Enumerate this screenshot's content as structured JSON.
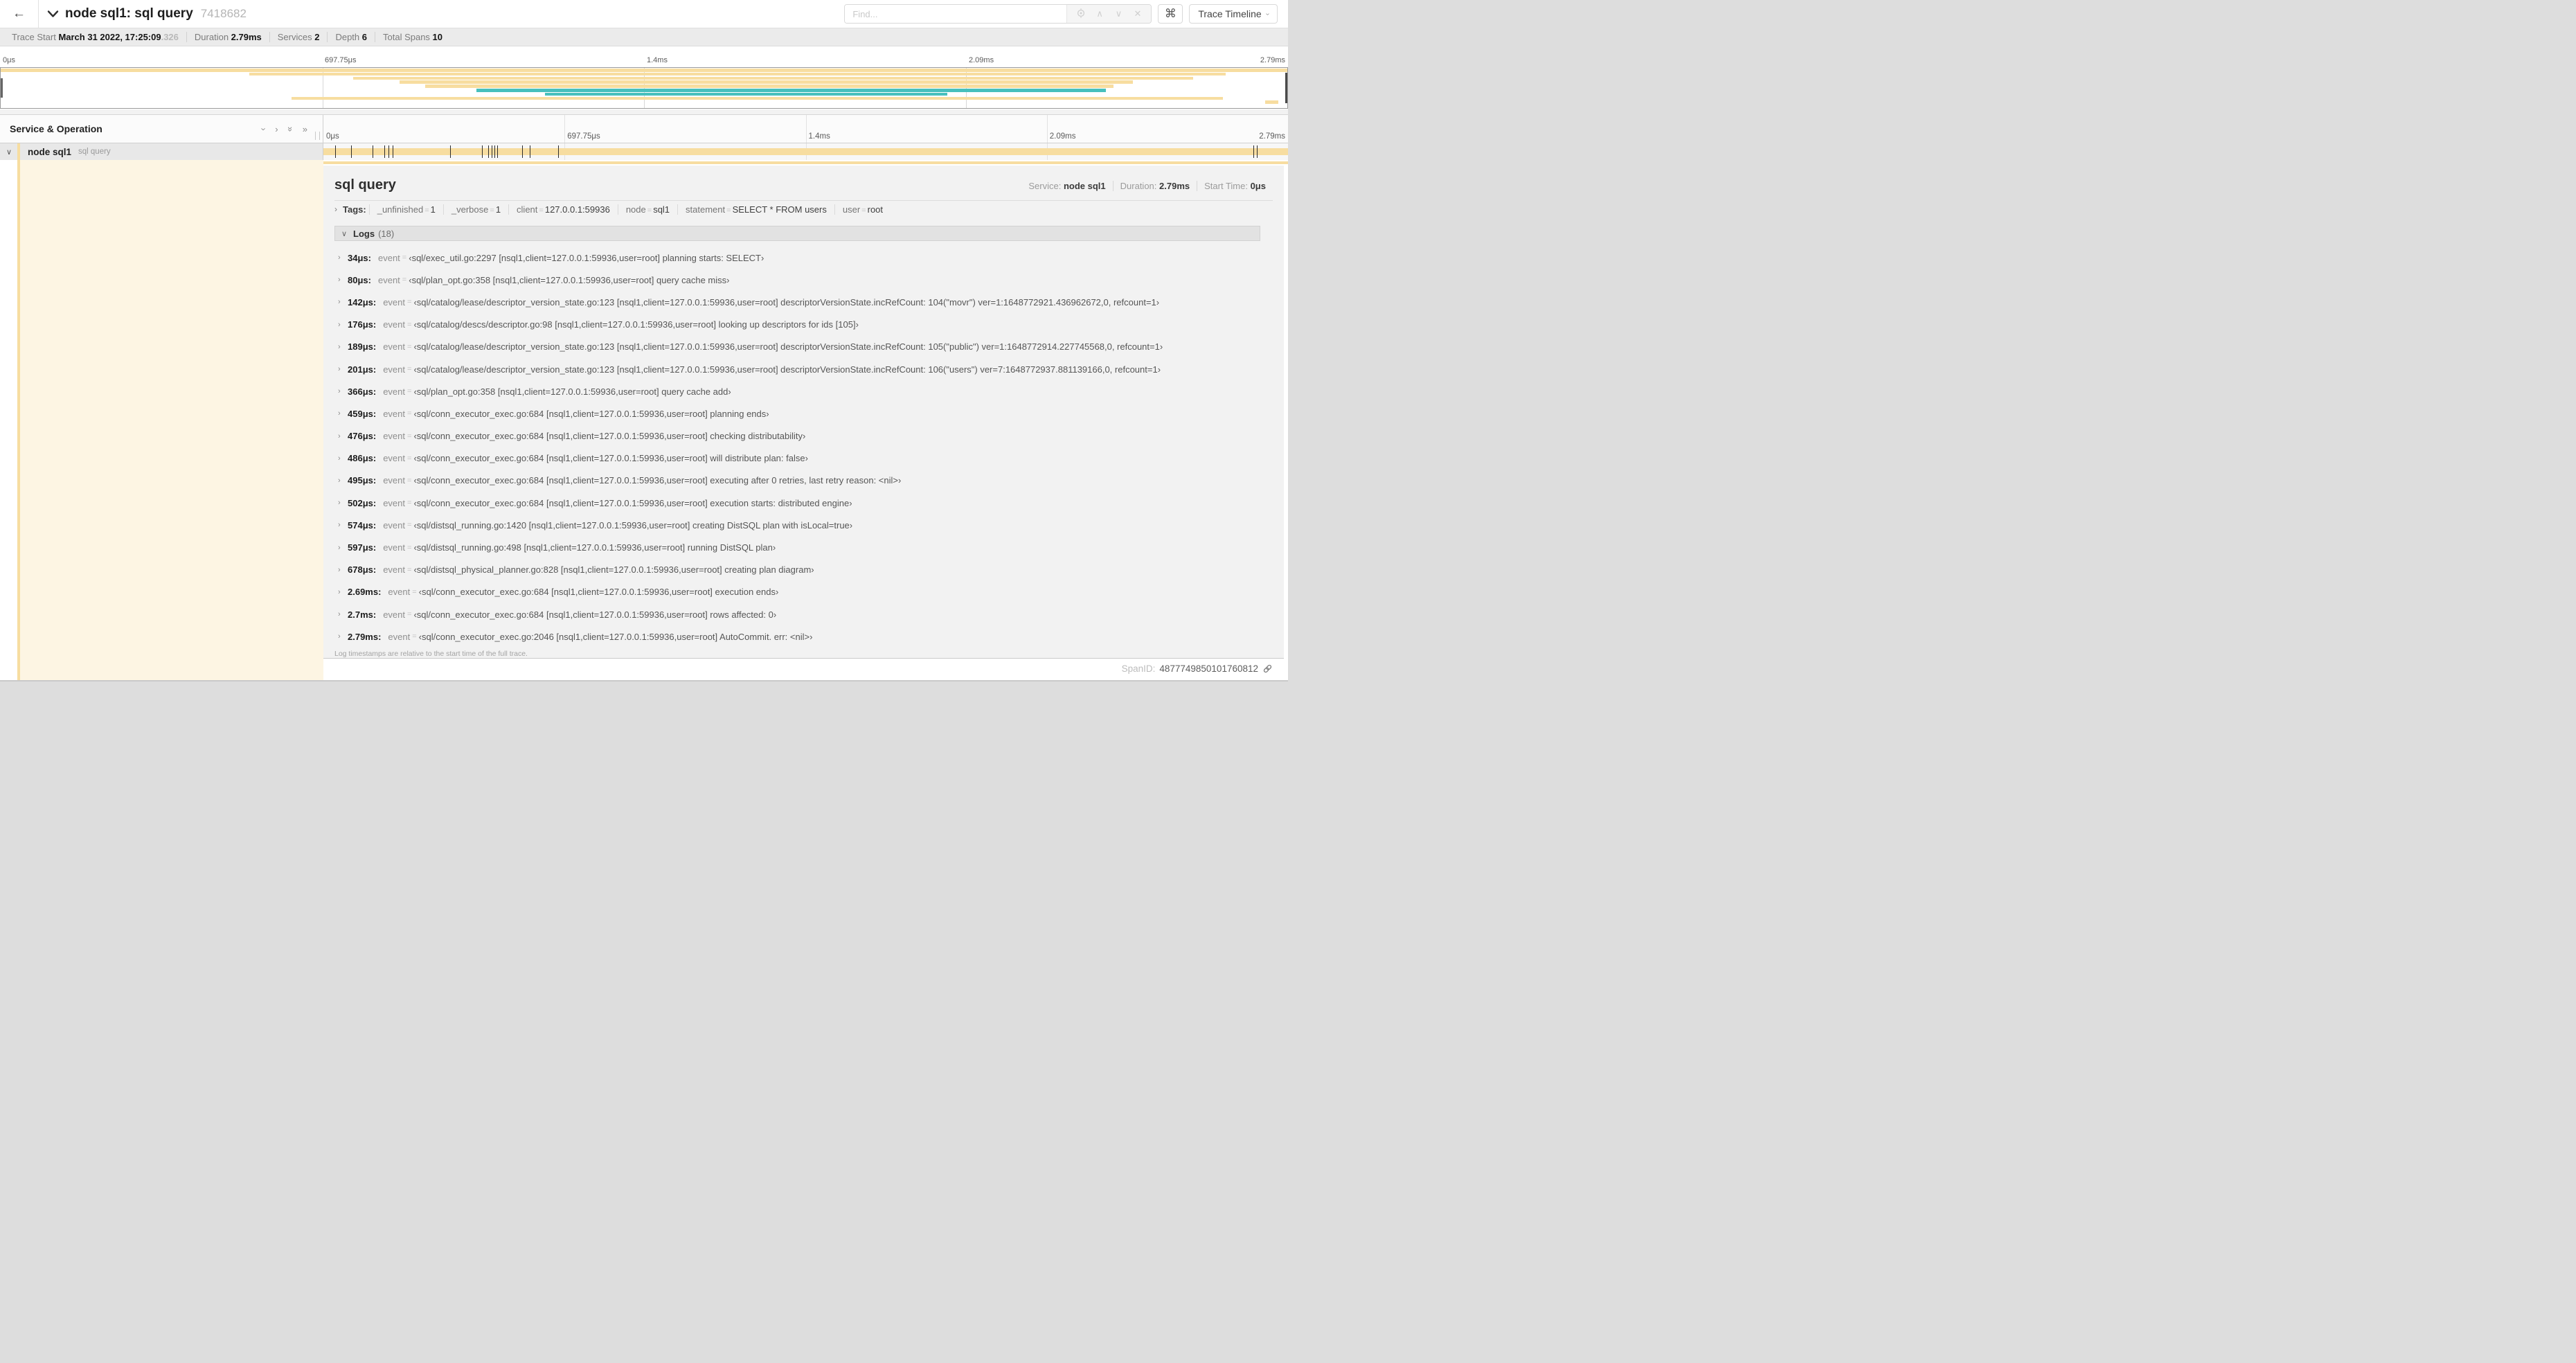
{
  "colors": {
    "span_tan": "#f7dda0",
    "span_teal": "#47c0bd",
    "pale_tan": "#fdf5e3",
    "tick": "#2b2b2b"
  },
  "header": {
    "back": "←",
    "title": "node sql1: sql query",
    "trace_id": "7418682",
    "find_placeholder": "Find...",
    "shortcut": "⌘",
    "view_selector": "Trace Timeline"
  },
  "trace_meta": [
    {
      "label": "Trace Start",
      "value": "March 31 2022, 17:25:09",
      "suffix": ".326"
    },
    {
      "label": "Duration",
      "value": "2.79ms",
      "suffix": ""
    },
    {
      "label": "Services",
      "value": "2",
      "suffix": ""
    },
    {
      "label": "Depth",
      "value": "6",
      "suffix": ""
    },
    {
      "label": "Total Spans",
      "value": "10",
      "suffix": ""
    }
  ],
  "ruler_ticks": [
    {
      "pos": 0,
      "label": "0μs"
    },
    {
      "pos": 25,
      "label": "697.75μs"
    },
    {
      "pos": 50,
      "label": "1.4ms"
    },
    {
      "pos": 75,
      "label": "2.09ms"
    },
    {
      "pos": 100,
      "label": "2.79ms"
    }
  ],
  "minimap": {
    "spans": [
      {
        "row": 0,
        "start": 0,
        "end": 100,
        "color": "tan"
      },
      {
        "row": 1,
        "start": 19.3,
        "end": 95.2,
        "color": "tan"
      },
      {
        "row": 2,
        "start": 27.4,
        "end": 92.7,
        "color": "tan"
      },
      {
        "row": 3,
        "start": 31.0,
        "end": 88.0,
        "color": "tan"
      },
      {
        "row": 4,
        "start": 33.0,
        "end": 86.5,
        "color": "tan"
      },
      {
        "row": 5,
        "start": 37.0,
        "end": 85.9,
        "color": "teal"
      },
      {
        "row": 6,
        "start": 42.3,
        "end": 73.6,
        "color": "teal"
      },
      {
        "row": 7,
        "start": 22.6,
        "end": 95.0,
        "color": "tan"
      },
      {
        "row": 8,
        "start": 98.3,
        "end": 99.3,
        "color": "tan"
      }
    ]
  },
  "timeline": {
    "left_header": "Service & Operation",
    "row": {
      "service": "node sql1",
      "operation": "sql query"
    },
    "duration_us": 2790,
    "log_marker_us": [
      34,
      80,
      142,
      176,
      189,
      201,
      366,
      459,
      476,
      486,
      495,
      502,
      574,
      597,
      678,
      2690,
      2700,
      2789
    ]
  },
  "detail": {
    "title": "sql query",
    "meta": [
      {
        "label": "Service:",
        "value": "node sql1"
      },
      {
        "label": "Duration:",
        "value": "2.79ms"
      },
      {
        "label": "Start Time:",
        "value": "0μs"
      }
    ],
    "tags_label": "Tags:",
    "tags": [
      {
        "key": "_unfinished",
        "value": "1"
      },
      {
        "key": "_verbose",
        "value": "1"
      },
      {
        "key": "client",
        "value": "127.0.0.1:59936"
      },
      {
        "key": "node",
        "value": "sql1"
      },
      {
        "key": "statement",
        "value": "SELECT * FROM users"
      },
      {
        "key": "user",
        "value": "root"
      }
    ],
    "logs_label": "Logs",
    "logs_count": "(18)",
    "log_field": "event",
    "logs": [
      {
        "time": "34μs:",
        "value": "‹sql/exec_util.go:2297 [nsql1,client=127.0.0.1:59936,user=root] planning starts: SELECT›"
      },
      {
        "time": "80μs:",
        "value": "‹sql/plan_opt.go:358 [nsql1,client=127.0.0.1:59936,user=root] query cache miss›"
      },
      {
        "time": "142μs:",
        "value": "‹sql/catalog/lease/descriptor_version_state.go:123 [nsql1,client=127.0.0.1:59936,user=root] descriptorVersionState.incRefCount: 104(\"movr\") ver=1:1648772921.436962672,0, refcount=1›"
      },
      {
        "time": "176μs:",
        "value": "‹sql/catalog/descs/descriptor.go:98 [nsql1,client=127.0.0.1:59936,user=root] looking up descriptors for ids [105]›"
      },
      {
        "time": "189μs:",
        "value": "‹sql/catalog/lease/descriptor_version_state.go:123 [nsql1,client=127.0.0.1:59936,user=root] descriptorVersionState.incRefCount: 105(\"public\") ver=1:1648772914.227745568,0, refcount=1›"
      },
      {
        "time": "201μs:",
        "value": "‹sql/catalog/lease/descriptor_version_state.go:123 [nsql1,client=127.0.0.1:59936,user=root] descriptorVersionState.incRefCount: 106(\"users\") ver=7:1648772937.881139166,0, refcount=1›"
      },
      {
        "time": "366μs:",
        "value": "‹sql/plan_opt.go:358 [nsql1,client=127.0.0.1:59936,user=root] query cache add›"
      },
      {
        "time": "459μs:",
        "value": "‹sql/conn_executor_exec.go:684 [nsql1,client=127.0.0.1:59936,user=root] planning ends›"
      },
      {
        "time": "476μs:",
        "value": "‹sql/conn_executor_exec.go:684 [nsql1,client=127.0.0.1:59936,user=root] checking distributability›"
      },
      {
        "time": "486μs:",
        "value": "‹sql/conn_executor_exec.go:684 [nsql1,client=127.0.0.1:59936,user=root] will distribute plan: false›"
      },
      {
        "time": "495μs:",
        "value": "‹sql/conn_executor_exec.go:684 [nsql1,client=127.0.0.1:59936,user=root] executing after 0 retries, last retry reason: <nil>›"
      },
      {
        "time": "502μs:",
        "value": "‹sql/conn_executor_exec.go:684 [nsql1,client=127.0.0.1:59936,user=root] execution starts: distributed engine›"
      },
      {
        "time": "574μs:",
        "value": "‹sql/distsql_running.go:1420 [nsql1,client=127.0.0.1:59936,user=root] creating DistSQL plan with isLocal=true›"
      },
      {
        "time": "597μs:",
        "value": "‹sql/distsql_running.go:498 [nsql1,client=127.0.0.1:59936,user=root] running DistSQL plan›"
      },
      {
        "time": "678μs:",
        "value": "‹sql/distsql_physical_planner.go:828 [nsql1,client=127.0.0.1:59936,user=root] creating plan diagram›"
      },
      {
        "time": "2.69ms:",
        "value": "‹sql/conn_executor_exec.go:684 [nsql1,client=127.0.0.1:59936,user=root] execution ends›"
      },
      {
        "time": "2.7ms:",
        "value": "‹sql/conn_executor_exec.go:684 [nsql1,client=127.0.0.1:59936,user=root] rows affected: 0›"
      },
      {
        "time": "2.79ms:",
        "value": "‹sql/conn_executor_exec.go:2046 [nsql1,client=127.0.0.1:59936,user=root] AutoCommit. err: <nil>›"
      }
    ],
    "footnote": "Log timestamps are relative to the start time of the full trace.",
    "span_id_label": "SpanID:",
    "span_id": "4877749850101760812"
  }
}
